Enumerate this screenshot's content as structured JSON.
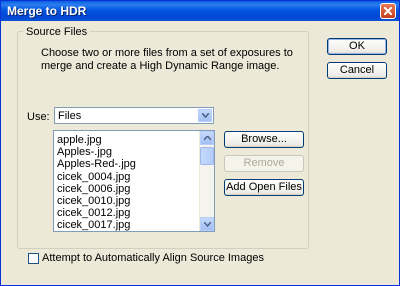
{
  "window": {
    "title": "Merge to HDR"
  },
  "source_files": {
    "group_label": "Source Files",
    "description": "Choose two or more files from a set of exposures to merge and create a High Dynamic Range image.",
    "use_label": "Use:",
    "use_value": "Files",
    "files": [
      "apple.jpg",
      "Apples-.jpg",
      "Apples-Red-.jpg",
      "cicek_0004.jpg",
      "cicek_0006.jpg",
      "cicek_0010.jpg",
      "cicek_0012.jpg",
      "cicek_0017.jpg"
    ],
    "scroll_fraction": 0.05
  },
  "buttons": {
    "ok": "OK",
    "cancel": "Cancel",
    "browse": "Browse...",
    "remove": "Remove",
    "add_open_files": "Add Open Files"
  },
  "align": {
    "label": "Attempt to Automatically Align Source Images",
    "checked": false
  }
}
